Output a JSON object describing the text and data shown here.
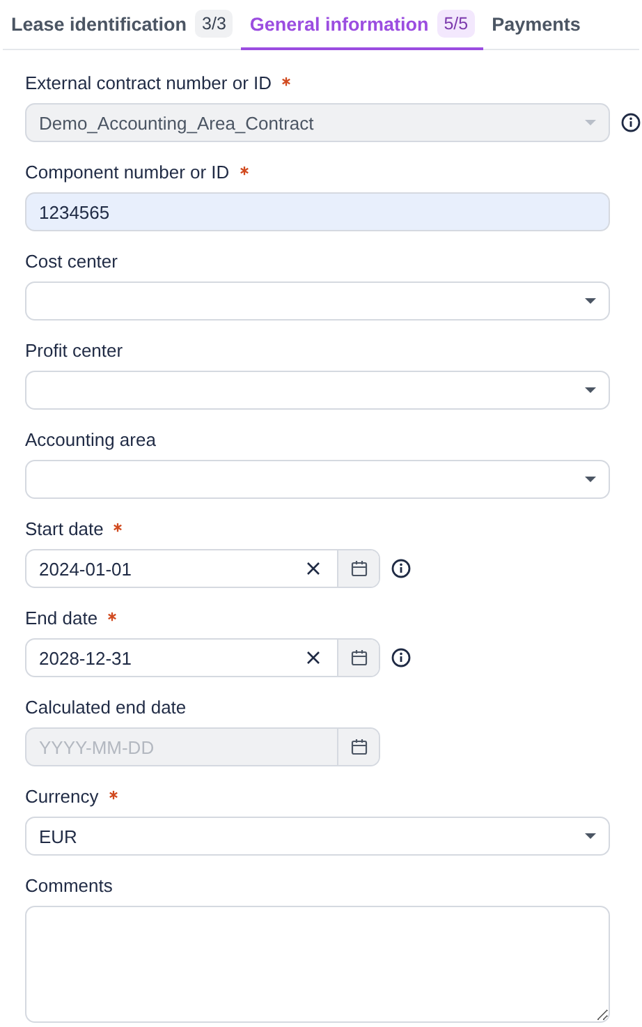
{
  "tabs": [
    {
      "label": "Lease identification",
      "count": "3/3",
      "selected": false
    },
    {
      "label": "General information",
      "count": "5/5",
      "selected": true
    },
    {
      "label": "Payments",
      "selected": false
    }
  ],
  "fields": [
    {
      "kind": "select",
      "label": "External contract number or ID",
      "required": true,
      "value": "Demo_Accounting_Area_Contract",
      "disabled": true,
      "info": true
    },
    {
      "kind": "text",
      "label": "Component number or ID",
      "required": true,
      "value": "1234565",
      "highlighted": true,
      "info": false
    },
    {
      "kind": "select",
      "label": "Cost center",
      "required": false,
      "disabled": false,
      "info": false
    },
    {
      "kind": "select",
      "label": "Profit center",
      "required": false,
      "disabled": false,
      "info": false
    },
    {
      "kind": "select",
      "label": "Accounting area",
      "required": false,
      "disabled": false,
      "info": false
    },
    {
      "kind": "date",
      "label": "Start date",
      "required": true,
      "value": "2024-01-01",
      "disabled": false,
      "info": true
    },
    {
      "kind": "date",
      "label": "End date",
      "required": true,
      "value": "2028-12-31",
      "disabled": false,
      "info": true
    },
    {
      "kind": "date",
      "label": "Calculated end date",
      "required": false,
      "placeholder": "YYYY-MM-DD",
      "disabled": true,
      "info": false
    },
    {
      "kind": "select",
      "label": "Currency",
      "required": true,
      "value": "EUR",
      "disabled": false,
      "info": false
    },
    {
      "kind": "textarea",
      "label": "Comments",
      "required": false
    }
  ]
}
